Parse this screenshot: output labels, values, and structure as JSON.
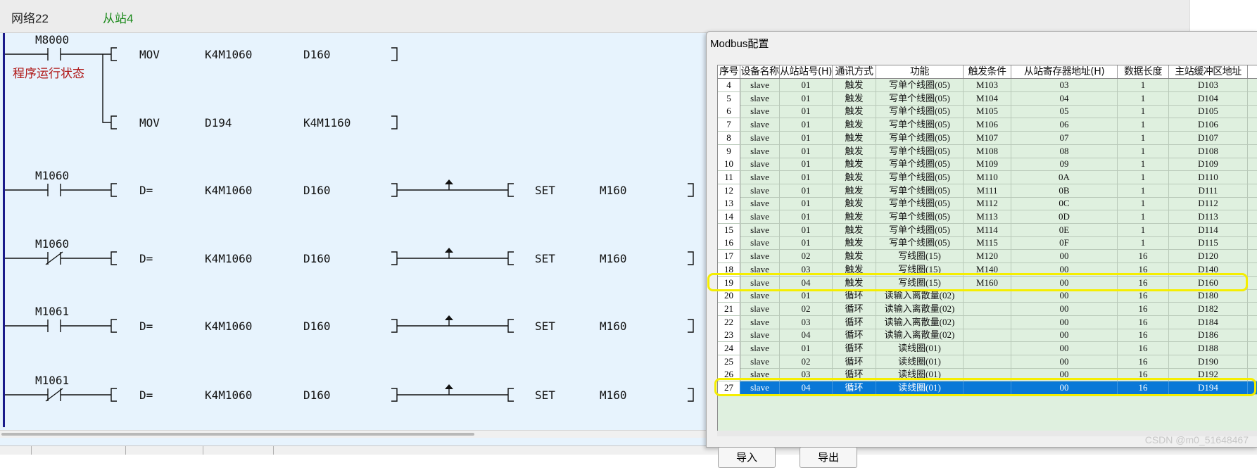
{
  "ladder": {
    "network_label": "网络22",
    "network_comment": "从站4",
    "contact_comment": "程序运行状态",
    "rungs": [
      {
        "contact": "M8000",
        "contact_type": "NO",
        "op": "MOV",
        "a": "K4M1060",
        "b": "D160",
        "set": null
      },
      {
        "contact": null,
        "contact_type": "branch",
        "op": "MOV",
        "a": "D194",
        "b": "K4M1160",
        "set": null
      },
      {
        "contact": "M1060",
        "contact_type": "NO",
        "op": "D=",
        "a": "K4M1060",
        "b": "D160",
        "set": {
          "op": "SET",
          "arg": "M160"
        }
      },
      {
        "contact": "M1060",
        "contact_type": "NC",
        "op": "D=",
        "a": "K4M1060",
        "b": "D160",
        "set": {
          "op": "SET",
          "arg": "M160"
        }
      },
      {
        "contact": "M1061",
        "contact_type": "NO",
        "op": "D=",
        "a": "K4M1060",
        "b": "D160",
        "set": {
          "op": "SET",
          "arg": "M160"
        }
      },
      {
        "contact": "M1061",
        "contact_type": "NC",
        "op": "D=",
        "a": "K4M1060",
        "b": "D160",
        "set": {
          "op": "SET",
          "arg": "M160"
        }
      }
    ]
  },
  "dialog": {
    "title": "Modbus配置",
    "columns": [
      "序号",
      "设备名称",
      "从站站号(H)",
      "通讯方式",
      "功能",
      "触发条件",
      "从站寄存器地址(H)",
      "数据长度",
      "主站缓冲区地址"
    ],
    "rows": [
      [
        "4",
        "slave",
        "01",
        "触发",
        "写单个线圈(05)",
        "M103",
        "03",
        "1",
        "D103"
      ],
      [
        "5",
        "slave",
        "01",
        "触发",
        "写单个线圈(05)",
        "M104",
        "04",
        "1",
        "D104"
      ],
      [
        "6",
        "slave",
        "01",
        "触发",
        "写单个线圈(05)",
        "M105",
        "05",
        "1",
        "D105"
      ],
      [
        "7",
        "slave",
        "01",
        "触发",
        "写单个线圈(05)",
        "M106",
        "06",
        "1",
        "D106"
      ],
      [
        "8",
        "slave",
        "01",
        "触发",
        "写单个线圈(05)",
        "M107",
        "07",
        "1",
        "D107"
      ],
      [
        "9",
        "slave",
        "01",
        "触发",
        "写单个线圈(05)",
        "M108",
        "08",
        "1",
        "D108"
      ],
      [
        "10",
        "slave",
        "01",
        "触发",
        "写单个线圈(05)",
        "M109",
        "09",
        "1",
        "D109"
      ],
      [
        "11",
        "slave",
        "01",
        "触发",
        "写单个线圈(05)",
        "M110",
        "0A",
        "1",
        "D110"
      ],
      [
        "12",
        "slave",
        "01",
        "触发",
        "写单个线圈(05)",
        "M111",
        "0B",
        "1",
        "D111"
      ],
      [
        "13",
        "slave",
        "01",
        "触发",
        "写单个线圈(05)",
        "M112",
        "0C",
        "1",
        "D112"
      ],
      [
        "14",
        "slave",
        "01",
        "触发",
        "写单个线圈(05)",
        "M113",
        "0D",
        "1",
        "D113"
      ],
      [
        "15",
        "slave",
        "01",
        "触发",
        "写单个线圈(05)",
        "M114",
        "0E",
        "1",
        "D114"
      ],
      [
        "16",
        "slave",
        "01",
        "触发",
        "写单个线圈(05)",
        "M115",
        "0F",
        "1",
        "D115"
      ],
      [
        "17",
        "slave",
        "02",
        "触发",
        "写线圈(15)",
        "M120",
        "00",
        "16",
        "D120"
      ],
      [
        "18",
        "slave",
        "03",
        "触发",
        "写线圈(15)",
        "M140",
        "00",
        "16",
        "D140"
      ],
      [
        "19",
        "slave",
        "04",
        "触发",
        "写线圈(15)",
        "M160",
        "00",
        "16",
        "D160"
      ],
      [
        "20",
        "slave",
        "01",
        "循环",
        "读输入离散量(02)",
        "",
        "00",
        "16",
        "D180"
      ],
      [
        "21",
        "slave",
        "02",
        "循环",
        "读输入离散量(02)",
        "",
        "00",
        "16",
        "D182"
      ],
      [
        "22",
        "slave",
        "03",
        "循环",
        "读输入离散量(02)",
        "",
        "00",
        "16",
        "D184"
      ],
      [
        "23",
        "slave",
        "04",
        "循环",
        "读输入离散量(02)",
        "",
        "00",
        "16",
        "D186"
      ],
      [
        "24",
        "slave",
        "01",
        "循环",
        "读线圈(01)",
        "",
        "00",
        "16",
        "D188"
      ],
      [
        "25",
        "slave",
        "02",
        "循环",
        "读线圈(01)",
        "",
        "00",
        "16",
        "D190"
      ],
      [
        "26",
        "slave",
        "03",
        "循环",
        "读线圈(01)",
        "",
        "00",
        "16",
        "D192"
      ],
      [
        "27",
        "slave",
        "04",
        "循环",
        "读线圈(01)",
        "",
        "00",
        "16",
        "D194"
      ]
    ],
    "selected_row": "27",
    "highlighted_rows": [
      "19",
      "27"
    ],
    "import_label": "导入",
    "export_label": "导出"
  },
  "watermark": "CSDN @m0_51648467",
  "colors": {
    "ladder_bg": "#e7f3fd",
    "network_comment": "#1b8a1b",
    "contact_comment": "#b01818",
    "grid_bg": "#dff0df",
    "selection": "#0a78d7",
    "highlight": "#f5ee00"
  }
}
